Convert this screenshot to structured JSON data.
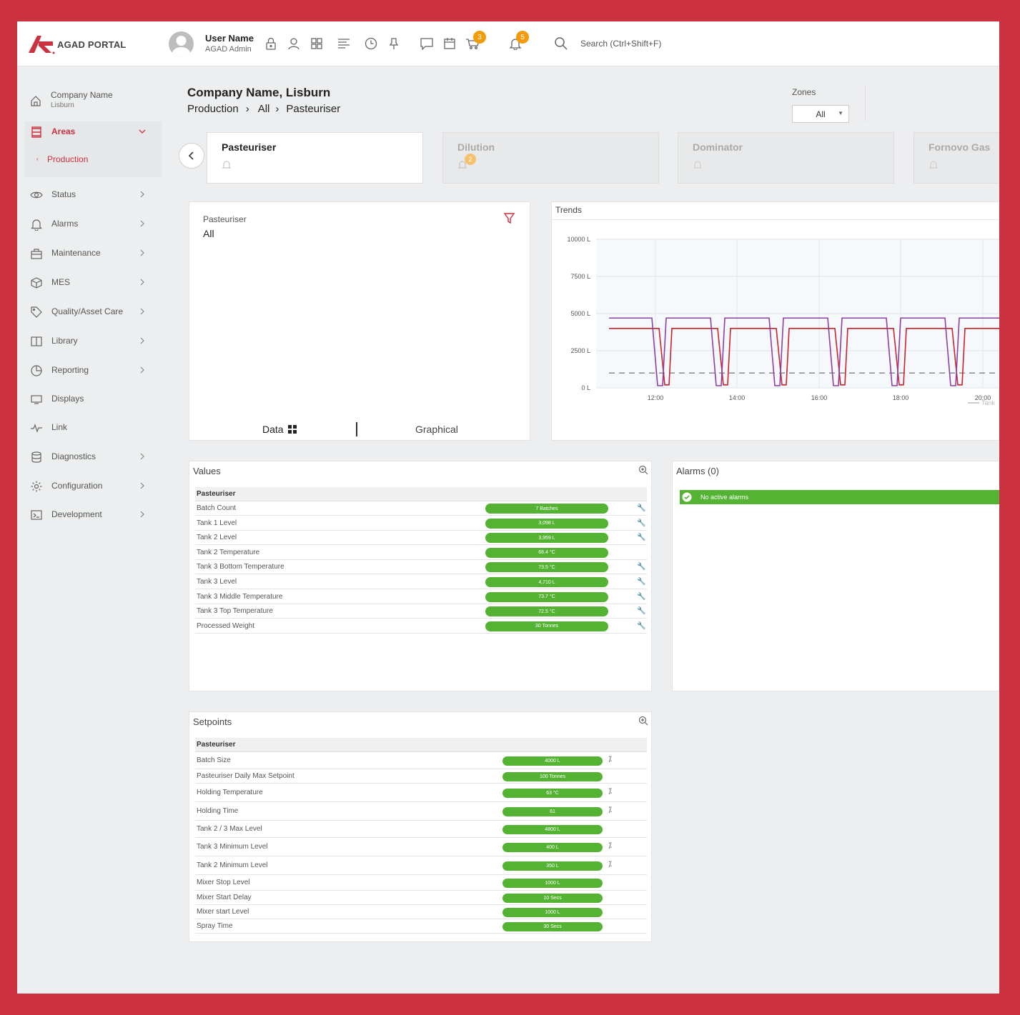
{
  "app": {
    "name": "AGAD PORTAL"
  },
  "user": {
    "name": "User Name",
    "role": "AGAD Admin"
  },
  "toolbar": {
    "icons": [
      "lock-icon",
      "user-icon",
      "grid-icon",
      "list-icon",
      "clock-icon",
      "pin-icon",
      "chat-icon",
      "calendar-icon",
      "cart-icon",
      "bell-icon"
    ],
    "cart_badge": "3",
    "bell_badge": "5",
    "search_label": "Search (Ctrl+Shift+F)"
  },
  "sidebar": {
    "company": "Company Name",
    "site": "Lisburn",
    "areas_label": "Areas",
    "production_label": "Production",
    "items": [
      {
        "label": "Status",
        "icon": "eye-icon"
      },
      {
        "label": "Alarms",
        "icon": "bell-icon"
      },
      {
        "label": "Maintenance",
        "icon": "toolbox-icon"
      },
      {
        "label": "MES",
        "icon": "cube-icon"
      },
      {
        "label": "Quality/Asset Care",
        "icon": "tag-icon"
      },
      {
        "label": "Library",
        "icon": "book-icon"
      },
      {
        "label": "Reporting",
        "icon": "pie-icon"
      },
      {
        "label": "Displays",
        "icon": "monitor-icon"
      },
      {
        "label": "Link",
        "icon": "pulse-icon"
      },
      {
        "label": "Diagnostics",
        "icon": "database-icon"
      },
      {
        "label": "Configuration",
        "icon": "gear-icon"
      },
      {
        "label": "Development",
        "icon": "terminal-icon"
      }
    ]
  },
  "header": {
    "title": "Company Name, Lisburn",
    "breadcrumb": [
      "Production",
      "All",
      "Pasteuriser"
    ],
    "zones_label": "Zones",
    "zones_value": "All"
  },
  "cards": [
    {
      "title": "Pasteuriser",
      "badge": ""
    },
    {
      "title": "Dilution",
      "badge": "2"
    },
    {
      "title": "Dominator",
      "badge": ""
    },
    {
      "title": "Fornovo Gas",
      "badge": ""
    }
  ],
  "info_panel": {
    "title": "Pasteuriser",
    "subtitle": "All",
    "tab_data": "Data",
    "tab_graphical": "Graphical"
  },
  "trends": {
    "title": "Trends"
  },
  "chart_data": {
    "type": "line",
    "title": "Trends",
    "y_ticks": [
      "10000 L",
      "7500 L",
      "5000 L",
      "2500 L",
      "0 L"
    ],
    "x_ticks": [
      "12:00",
      "14:00",
      "16:00",
      "18:00",
      "20:00"
    ],
    "ylim": [
      0,
      10000
    ],
    "x": [
      "10:40",
      "11:30",
      "12:50",
      "14:20",
      "15:40",
      "17:00",
      "18:30",
      "19:50",
      "20:40"
    ],
    "series": [
      {
        "name": "Tank",
        "color": "#8c3fa6",
        "values": [
          4700,
          4700,
          4700,
          4700,
          4700,
          4700,
          4700,
          4700,
          4700
        ]
      },
      {
        "name": "",
        "color": "#d0202a",
        "values": [
          4000,
          4000,
          4000,
          4000,
          4000,
          4000,
          4000,
          4000,
          4000
        ]
      },
      {
        "name": "",
        "color": "#666666",
        "dashed": true,
        "values": [
          1000,
          1000,
          1000,
          1000,
          1000,
          1000,
          1000,
          1000,
          1000
        ]
      }
    ],
    "legend": "Tank",
    "legend_position": "bottom-right"
  },
  "values_panel": {
    "title": "Values",
    "group": "Pasteuriser",
    "rows": [
      {
        "name": "Batch Count",
        "value": "7 Batches",
        "wrench": true
      },
      {
        "name": "Tank 1 Level",
        "value": "3,098 L",
        "wrench": true
      },
      {
        "name": "Tank 2 Level",
        "value": "3,959 L",
        "wrench": true
      },
      {
        "name": "Tank 2 Temperature",
        "value": "68.4 °C",
        "wrench": false
      },
      {
        "name": "Tank 3 Bottom Temperature",
        "value": "73.5 °C",
        "wrench": true
      },
      {
        "name": "Tank 3 Level",
        "value": "4,710 L",
        "wrench": true
      },
      {
        "name": "Tank 3 Middle Temperature",
        "value": "73.7 °C",
        "wrench": true
      },
      {
        "name": "Tank 3 Top Temperature",
        "value": "72.5 °C",
        "wrench": true
      },
      {
        "name": "Processed Weight",
        "value": "30 Tonnes",
        "wrench": true
      }
    ]
  },
  "alarms_panel": {
    "title": "Alarms (0)",
    "message": "No active alarms"
  },
  "setpoints_panel": {
    "title": "Setpoints",
    "group": "Pasteuriser",
    "rows": [
      {
        "name": "Batch Size",
        "value": "4000 L",
        "edit": true
      },
      {
        "name": "Pasteuriser Daily Max Setpoint",
        "value": "100 Tonnes",
        "edit": false
      },
      {
        "name": "Holding Temperature",
        "value": "63 °C",
        "edit": true
      },
      {
        "name": "Holding Time",
        "value": "61",
        "edit": true
      },
      {
        "name": "Tank 2 / 3 Max Level",
        "value": "4800 L",
        "edit": false
      },
      {
        "name": "Tank 3 Minimum Level",
        "value": "400 L",
        "edit": true
      },
      {
        "name": "Tank 2 Minimum Level",
        "value": "350 L",
        "edit": true
      },
      {
        "name": "Mixer Stop Level",
        "value": "1000 L",
        "edit": false
      },
      {
        "name": "Mixer Start Delay",
        "value": "10 Secs",
        "edit": false
      },
      {
        "name": "Mixer start Level",
        "value": "1000 L",
        "edit": false
      },
      {
        "name": "Spray Time",
        "value": "30 Secs",
        "edit": false
      }
    ]
  },
  "colors": {
    "brand": "#cc3140",
    "accent_green": "#55b333",
    "badge": "#f29b0d"
  }
}
